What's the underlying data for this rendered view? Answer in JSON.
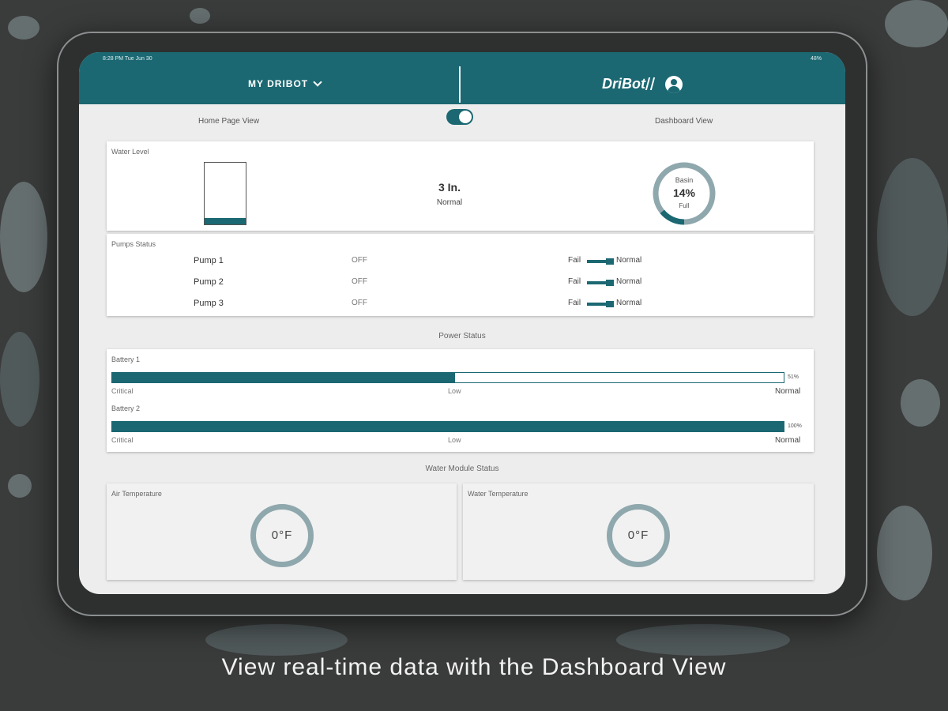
{
  "statusbar": {
    "time": "8:28 PM   Tue Jun 30",
    "battery": "48%"
  },
  "header": {
    "device_select": "MY DRIBOT",
    "brand": "DriBot"
  },
  "view_toggle": {
    "left_label": "Home Page View",
    "right_label": "Dashboard View",
    "dashboard_on": true
  },
  "water_level": {
    "title": "Water Level",
    "tank_fill_fraction": 0.1,
    "value": "3 In.",
    "status": "Normal",
    "basin": {
      "label_top": "Basin",
      "percent": "14%",
      "percent_value": 14,
      "label_bottom": "Full"
    }
  },
  "pumps": {
    "title": "Pumps Status",
    "fail_label": "Fail",
    "normal_label": "Normal",
    "items": [
      {
        "name": "Pump 1",
        "state": "OFF"
      },
      {
        "name": "Pump 2",
        "state": "OFF"
      },
      {
        "name": "Pump 3",
        "state": "OFF"
      }
    ]
  },
  "power": {
    "title": "Power Status",
    "scale": {
      "critical": "Critical",
      "low": "Low",
      "normal": "Normal"
    },
    "batteries": [
      {
        "label": "Battery 1",
        "percent": "51%",
        "value": 51
      },
      {
        "label": "Battery 2",
        "percent": "100%",
        "value": 100
      }
    ]
  },
  "water_module": {
    "title": "Water Module Status",
    "air": {
      "label": "Air Temperature",
      "value": "0°F"
    },
    "water": {
      "label": "Water Temperature",
      "value": "0°F"
    }
  },
  "caption": "View real-time data with the Dashboard View",
  "colors": {
    "accent": "#1b6872",
    "ring": "#8fa8ad"
  }
}
